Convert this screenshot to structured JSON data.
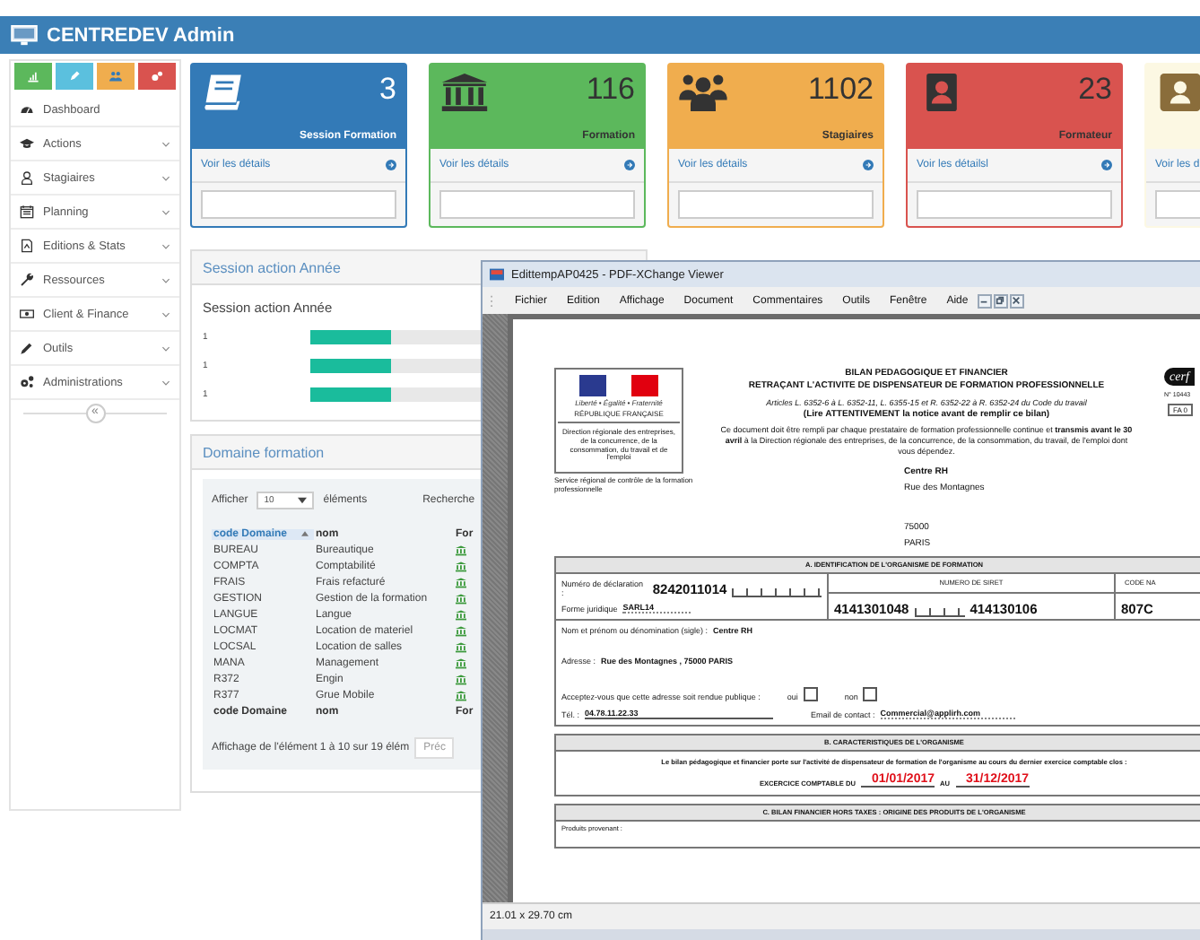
{
  "header": {
    "title": "CENTREDEV Admin"
  },
  "sidebar": {
    "shortcuts": [
      {
        "color": "#5cb85c"
      },
      {
        "color": "#5bc0de"
      },
      {
        "color": "#f0ad4e"
      },
      {
        "color": "#d9534f"
      }
    ],
    "items": [
      {
        "label": "Dashboard",
        "expandable": false
      },
      {
        "label": "Actions",
        "expandable": true
      },
      {
        "label": "Stagiaires",
        "expandable": true
      },
      {
        "label": "Planning",
        "expandable": true
      },
      {
        "label": "Editions & Stats",
        "expandable": true
      },
      {
        "label": "Ressources",
        "expandable": true
      },
      {
        "label": "Client & Finance",
        "expandable": true
      },
      {
        "label": "Outils",
        "expandable": true
      },
      {
        "label": "Administrations",
        "expandable": true
      }
    ],
    "collapse_label": "«"
  },
  "cards": [
    {
      "value": "3",
      "label": "Session Formation",
      "link": "Voir les détails",
      "color": "#337ab7",
      "kind": "light"
    },
    {
      "value": "116",
      "label": "Formation",
      "link": "Voir les détails",
      "color": "#5cb85c",
      "kind": "dark"
    },
    {
      "value": "1102",
      "label": "Stagiaires",
      "link": "Voir les détails",
      "color": "#f0ad4e",
      "kind": "dark"
    },
    {
      "value": "23",
      "label": "Formateur",
      "link": "Voir les détailsl",
      "color": "#d9534f",
      "kind": "dark"
    },
    {
      "link": "Voir les d",
      "color": "#fcf8e3",
      "kind": "pale"
    }
  ],
  "session_panel": {
    "heading": "Session action Année",
    "chart_title": "Session action Année",
    "rows": [
      {
        "label": "1",
        "level": 0.25
      },
      {
        "label": "1",
        "level": 0.25
      },
      {
        "label": "1",
        "level": 0.25
      }
    ]
  },
  "domain_panel": {
    "heading": "Domaine formation",
    "show_label": "Afficher",
    "page_size": "10",
    "entries_label": "éléments",
    "search_label": "Recherche",
    "columns": [
      {
        "label": "code Domaine",
        "sorted": true
      },
      {
        "label": "nom",
        "sorted": false
      },
      {
        "label": "For",
        "sorted": false
      }
    ],
    "rows": [
      {
        "code": "BUREAU",
        "name": "Bureautique"
      },
      {
        "code": "COMPTA",
        "name": "Comptabilité"
      },
      {
        "code": "FRAIS",
        "name": "Frais refacturé"
      },
      {
        "code": "GESTION",
        "name": "Gestion de la formation"
      },
      {
        "code": "LANGUE",
        "name": "Langue"
      },
      {
        "code": "LOCMAT",
        "name": "Location de materiel"
      },
      {
        "code": "LOCSAL",
        "name": "Location de salles"
      },
      {
        "code": "MANA",
        "name": "Management"
      },
      {
        "code": "R372",
        "name": "Engin"
      },
      {
        "code": "R377",
        "name": "Grue Mobile"
      }
    ],
    "footer": [
      "code Domaine",
      "nom",
      "For"
    ],
    "info": "Affichage de l'élément 1 à 10 sur 19 élém",
    "prev": "Préc"
  },
  "pdf_viewer": {
    "title": "EdittempAP0425 - PDF-XChange Viewer",
    "menu": [
      "Fichier",
      "Edition",
      "Affichage",
      "Document",
      "Commentaires",
      "Outils",
      "Fenêtre",
      "Aide"
    ],
    "status": "21.01 x 29.70 cm",
    "document": {
      "logo_motto": "Liberté • Égalité • Fraternité",
      "logo_name": "RÉPUBLIQUE FRANÇAISE",
      "logo_direction": "Direction régionale des entreprises, de la concurrence, de la consommation, du travail et de l'emploi",
      "service": "Service régional de contrôle de la formation professionnelle",
      "title_1": "BILAN PEDAGOGIQUE ET FINANCIER",
      "title_2": "RETRAÇANT L'ACTIVITE DE DISPENSATEUR DE FORMATION PROFESSIONNELLE",
      "articles": "Articles L. 6352-6 à L. 6352-11, L. 6355-15 et R. 6352-22 à R. 6352-24 du Code du travail",
      "notice": "(Lire **ATTENTIVEMENT** la notice avant de remplir ce bilan)",
      "intro": "Ce document doit être rempli par chaque prestataire de formation professionnelle continue et **transmis avant le 30 avril** à la Direction régionale des entreprises, de la concurrence, de la consommation, du travail, de l'emploi dont vous dépendez.",
      "cerfa": "cerf",
      "cerfa_number": "N° 10443",
      "form_code": "FA 0",
      "address": [
        "Centre RH",
        "Rue des Montagnes",
        "75000",
        "PARIS"
      ],
      "section_a": {
        "heading": "A. IDENTIFICATION DE L'ORGANISME DE FORMATION",
        "declaration_label": "Numéro de déclaration :",
        "declaration": "8242011014",
        "legal_form_label": "Forme juridique",
        "legal_form": "SARL14",
        "siret_heading": "NUMERO DE SIRET",
        "siret_1": "4141301048",
        "siret_2": "414130106",
        "code_heading": "CODE NA",
        "code": "807C",
        "name_label": "Nom et prénom ou dénomination (sigle) :",
        "name": "Centre RH",
        "address_label": "Adresse :",
        "address": "Rue des Montagnes  , 75000 PARIS",
        "public_label": "Acceptez-vous que cette adresse soit rendue publique :",
        "choices": [
          {
            "label": "oui",
            "checked": false
          },
          {
            "label": "non",
            "checked": false
          }
        ],
        "phone_label": "Tél. :",
        "phone": "04.78.11.22.33",
        "email_label": "Email de contact :",
        "email": "Commercial@applirh.com"
      },
      "section_b": {
        "heading": "B. CARACTERISTIQUES DE L'ORGANISME",
        "text": "Le bilan pédagogique et financier porte sur l'activité de dispensateur de formation de l'organisme au cours du dernier exercice comptable clos :",
        "period_label": "EXCERCICE COMPTABLE DU",
        "start": "01/01/2017",
        "to_label": "AU",
        "end": "31/12/2017"
      },
      "section_c": {
        "heading": "C. BILAN FINANCIER HORS TAXES : ORIGINE DES PRODUITS DE L'ORGANISME",
        "text": "Produits provenant :"
      }
    }
  }
}
